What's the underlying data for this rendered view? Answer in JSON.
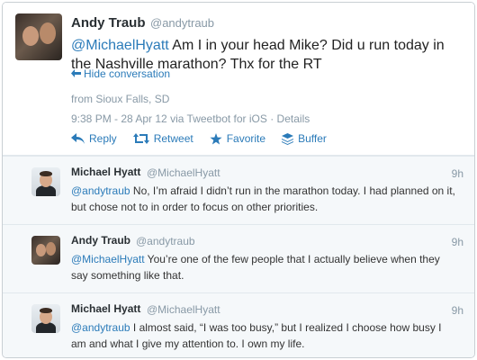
{
  "main_tweet": {
    "author_name": "Andy Traub",
    "author_handle": "@andytraub",
    "mention": "@MichaelHyatt",
    "text": " Am I in your head Mike? Did u run today in the Nashville marathon? Thx for the RT",
    "hide_conversation": "Hide conversation",
    "location": "from Sioux Falls, SD",
    "meta": "9:38 PM - 28 Apr 12 via Tweetbot for iOS · Details",
    "actions": {
      "reply": "Reply",
      "retweet": "Retweet",
      "favorite": "Favorite",
      "buffer": "Buffer"
    }
  },
  "replies": [
    {
      "author_name": "Michael Hyatt",
      "author_handle": "@MichaelHyatt",
      "time": "9h",
      "mention": "@andytraub",
      "text": " No, I’m afraid I didn’t run in the marathon today. I had planned on it, but chose not to in order to focus on other priorities."
    },
    {
      "author_name": "Andy Traub",
      "author_handle": "@andytraub",
      "time": "9h",
      "mention": "@MichaelHyatt",
      "text": " You’re one of the few people that I actually believe when they say something like that."
    },
    {
      "author_name": "Michael Hyatt",
      "author_handle": "@MichaelHyatt",
      "time": "9h",
      "mention": "@andytraub",
      "text": " I almost said, “I was too busy,” but I realized I choose how busy I am and what I give my attention to. I own my life."
    }
  ],
  "colors": {
    "link": "#2b7bb9",
    "muted": "#8899a6",
    "reply_bg": "#f5f8fa"
  },
  "icons": [
    "reply-icon",
    "retweet-icon",
    "star-icon",
    "buffer-icon",
    "back-arrow-icon"
  ]
}
